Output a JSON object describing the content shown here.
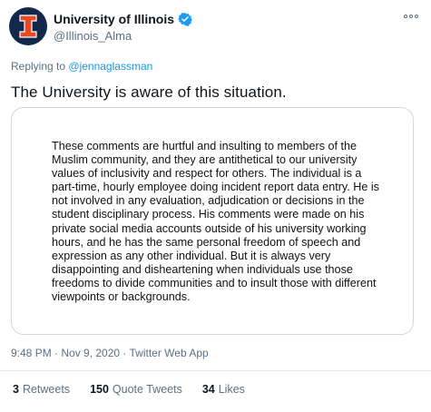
{
  "author": {
    "display_name": "University of Illinois",
    "handle": "@Illinois_Alma",
    "avatar_icon": "illinois-block-i-logo",
    "verified_icon": "verified-badge-icon",
    "brand_colors": {
      "navy": "#13294b",
      "orange": "#e84a27"
    }
  },
  "reply": {
    "prefix": "Replying to",
    "mention": "@jennaglassman"
  },
  "tweet_text": "The University is aware of this situation.",
  "quoted_statement": "These comments are hurtful and insulting to members of the Muslim community, and they are antithetical to our university values of inclusivity and respect for others. The individual is a part-time, hourly employee doing incident report data entry. He is not involved in any evaluation, adjudication or decisions in the student disciplinary process. His comments were made on his private social media accounts outside of his university working hours, and he has the same personal freedom of speech and expression as any other individual. But it is always very disappointing and disheartening when individuals use those freedoms to divide communities and to insult those with different viewpoints or backgrounds.",
  "meta": "9:48 PM · Nov 9, 2020 · Twitter Web App",
  "stats": {
    "retweets": {
      "count": "3",
      "label": "Retweets"
    },
    "quote_tweets": {
      "count": "150",
      "label": "Quote Tweets"
    },
    "likes": {
      "count": "34",
      "label": "Likes"
    }
  },
  "more_icon": "more-options-icon",
  "colors": {
    "link": "#1b95e0",
    "secondary_text": "#5b7083",
    "border": "#cfd9de"
  }
}
